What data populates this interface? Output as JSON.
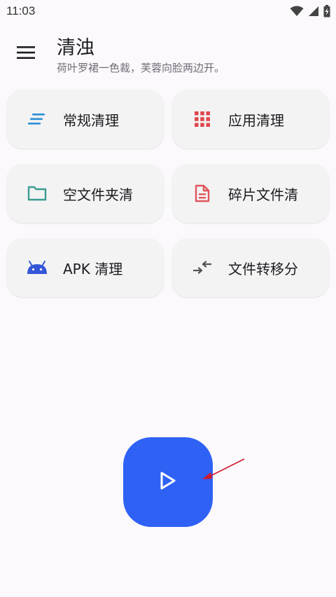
{
  "status_bar": {
    "time": "11:03",
    "icons": [
      "wifi-icon",
      "cellular-signal-icon",
      "battery-charging-icon"
    ]
  },
  "header": {
    "menu_icon": "menu-icon",
    "title": "清浊",
    "subtitle": "荷叶罗裙一色裁，芙蓉向脸两边开。"
  },
  "cards": [
    {
      "label": "常规清理",
      "icon": "list-lines-icon",
      "color": "#2b8fd6"
    },
    {
      "label": "应用清理",
      "icon": "app-grid-icon",
      "color": "#e0454c"
    },
    {
      "label": "空文件夹清",
      "icon": "folder-icon",
      "color": "#3a9b8f"
    },
    {
      "label": "碎片文件清",
      "icon": "document-icon",
      "color": "#e0555c"
    },
    {
      "label": "APK 清理",
      "icon": "android-icon",
      "color": "#3456d8"
    },
    {
      "label": "文件转移分",
      "icon": "compress-arrows-icon",
      "color": "#555555"
    }
  ],
  "fab": {
    "icon": "play-icon",
    "color": "#2f62f4"
  },
  "annotation": {
    "arrow_color": "#d0182b"
  }
}
